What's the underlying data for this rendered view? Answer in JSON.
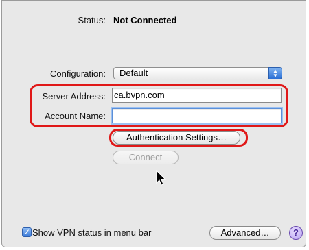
{
  "status": {
    "label": "Status:",
    "value": "Not Connected"
  },
  "configuration": {
    "label": "Configuration:",
    "selected": "Default"
  },
  "server_address": {
    "label": "Server Address:",
    "value": "ca.bvpn.com"
  },
  "account_name": {
    "label": "Account Name:",
    "value": ""
  },
  "buttons": {
    "auth_settings": "Authentication Settings…",
    "connect": "Connect",
    "advanced": "Advanced…",
    "help": "?"
  },
  "show_vpn_status": {
    "label": "Show VPN status in menu bar",
    "checked": true
  },
  "colors": {
    "highlight": "#e01818",
    "accent": "#3a7ad8",
    "panel": "#e8e8e8"
  }
}
